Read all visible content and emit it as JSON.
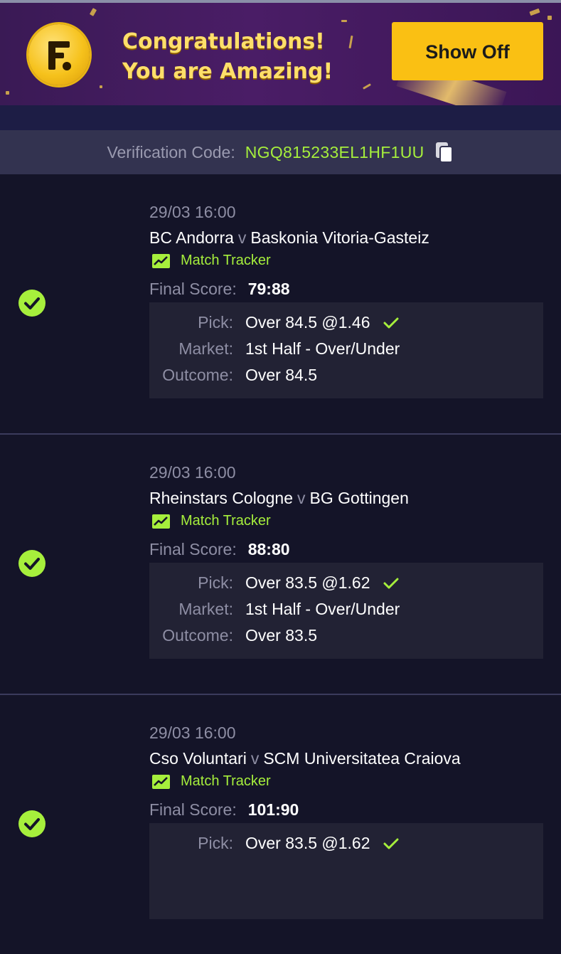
{
  "banner": {
    "line1": "Congratulations!",
    "line2": "You are Amazing!",
    "button_label": "Show Off",
    "accent": "#fac013"
  },
  "verification": {
    "label": "Verification Code:",
    "code": "NGQ815233EL1HF1UU"
  },
  "bets": [
    {
      "date": "29/03 16:00",
      "home": "BC Andorra",
      "vs": "v",
      "away": "Baskonia Vitoria-Gasteiz",
      "tracker_label": "Match Tracker",
      "final_label": "Final Score:",
      "final_score": "79:88",
      "pick_label": "Pick:",
      "pick": "Over 84.5 @1.46",
      "market_label": "Market:",
      "market": "1st Half - Over/Under",
      "outcome_label": "Outcome:",
      "outcome": "Over 84.5",
      "status": "won"
    },
    {
      "date": "29/03 16:00",
      "home": "Rheinstars Cologne",
      "vs": "v",
      "away": "BG Gottingen",
      "tracker_label": "Match Tracker",
      "final_label": "Final Score:",
      "final_score": "88:80",
      "pick_label": "Pick:",
      "pick": "Over 83.5 @1.62",
      "market_label": "Market:",
      "market": "1st Half - Over/Under",
      "outcome_label": "Outcome:",
      "outcome": "Over 83.5",
      "status": "won"
    },
    {
      "date": "29/03 16:00",
      "home": "Cso Voluntari",
      "vs": "v",
      "away": "SCM Universitatea Craiova",
      "tracker_label": "Match Tracker",
      "final_label": "Final Score:",
      "final_score": "101:90",
      "pick_label": "Pick:",
      "pick": "Over 83.5 @1.62",
      "status": "won"
    }
  ],
  "icons": {
    "status": "check-circle-icon",
    "tracker": "chart-line-icon",
    "copy": "copy-icon",
    "logo": "brand-logo"
  },
  "colors": {
    "background": "#141428",
    "green": "#a6ef3c",
    "muted": "#8e8ea4"
  }
}
